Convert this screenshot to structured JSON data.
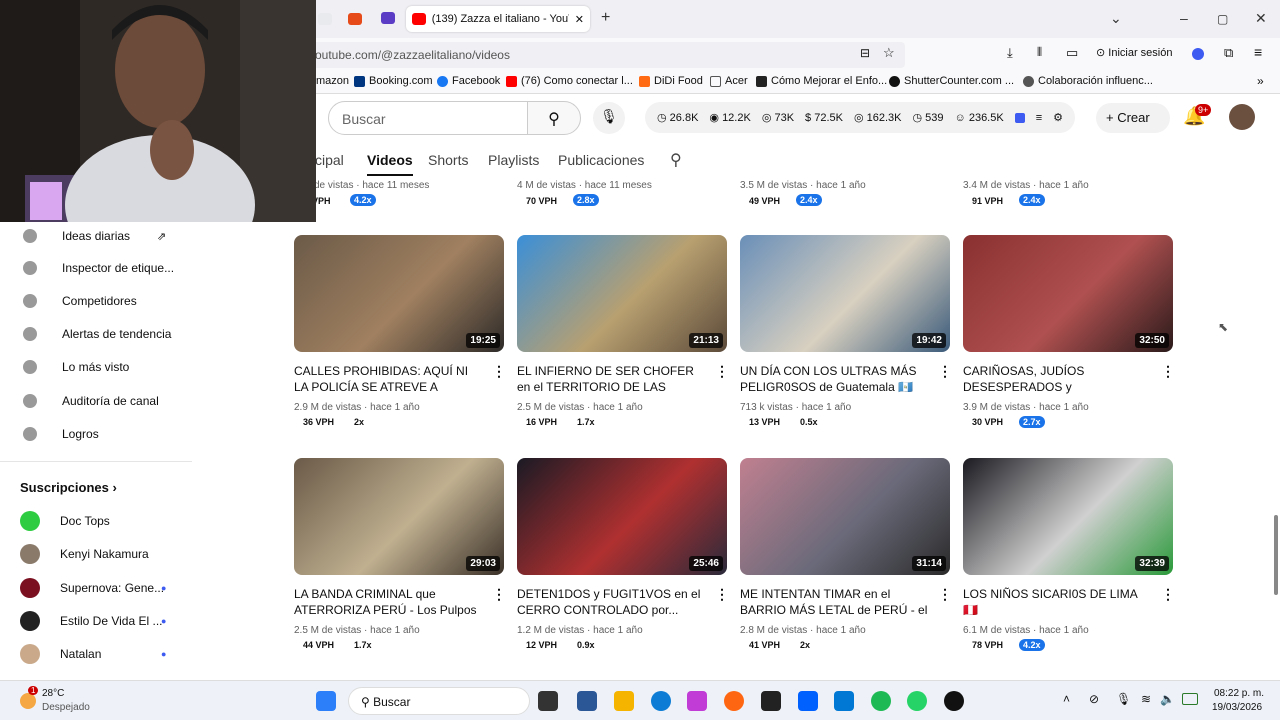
{
  "browser": {
    "active_tab_title": "(139) Zazza el italiano - YouTub",
    "url": "outube.com/@zazzaelitaliano/videos",
    "sign_in": "Iniciar sesión",
    "new_tab": "+",
    "bookmarks": [
      "mazon",
      "Booking.com",
      "Facebook",
      "(76) Como conectar l...",
      "DiDi Food",
      "Acer",
      "Cómo Mejorar el Enfo...",
      "ShutterCounter.com ...",
      "Colaboración influenc..."
    ]
  },
  "youtube": {
    "search_placeholder": "Buscar",
    "stats": [
      "26.8K",
      "12.2K",
      "73K",
      "72.5K",
      "162.3K",
      "539",
      "236.5K"
    ],
    "create_label": "Crear",
    "notif_badge": "9+",
    "channel_tabs": [
      "cipal",
      "Videos",
      "Shorts",
      "Playlists",
      "Publicaciones"
    ]
  },
  "sidebar": {
    "tools": [
      "Ideas diarias",
      "Inspector de etique...",
      "Competidores",
      "Alertas de tendencia",
      "Lo más visto",
      "Auditoría de canal",
      "Logros"
    ],
    "subs_title": "Suscripciones",
    "subscriptions": [
      "Doc Tops",
      "Kenyi Nakamura",
      "Supernova: Gene...",
      "Estilo De Vida El ...",
      "Natalan"
    ]
  },
  "top_row": [
    {
      "meta": "de vistas · hace 11 meses",
      "vph": "VPH",
      "mult": "4.2x"
    },
    {
      "meta": "4 M de vistas · hace 11 meses",
      "vph": "70 VPH",
      "mult": "2.8x"
    },
    {
      "meta": "3.5 M de vistas · hace 1 año",
      "vph": "49 VPH",
      "mult": "2.4x"
    },
    {
      "meta": "3.4 M de vistas · hace 1 año",
      "vph": "91 VPH",
      "mult": "2.4x"
    }
  ],
  "videos": [
    {
      "title": "CALLES PROHIBIDAS: AQUÍ NI LA POLICÍA SE ATREVE A ENTRAR - L...",
      "duration": "19:25",
      "meta": "2.9 M de vistas · hace 1 año",
      "vph": "36 VPH",
      "mult": "2x",
      "hi": false
    },
    {
      "title": "EL INFIERNO DE SER CHOFER en el TERRITORIO DE LAS MARAS 💀🇬🇹",
      "duration": "21:13",
      "meta": "2.5 M de vistas · hace 1 año",
      "vph": "16 VPH",
      "mult": "1.7x",
      "hi": false
    },
    {
      "title": "UN DÍA CON LOS ULTRAS MÁS PELIGR0SOS de Guatemala 🇬🇹",
      "duration": "19:42",
      "meta": "713 k vistas · hace 1 año",
      "vph": "13 VPH",
      "mult": "0.5x",
      "hi": false
    },
    {
      "title": "CARIÑOSAS, JUDÍOS DESESPERADOS y SECUESTR0S e...",
      "duration": "32:50",
      "meta": "3.9 M de vistas · hace 1 año",
      "vph": "30 VPH",
      "mult": "2.7x",
      "hi": true
    },
    {
      "title": "LA BANDA CRIMINAL que ATERRORIZA PERÚ - Los Pulpos 🇵🇪",
      "duration": "29:03",
      "meta": "2.5 M de vistas · hace 1 año",
      "vph": "44 VPH",
      "mult": "1.7x",
      "hi": false
    },
    {
      "title": "DETEN1DOS y FUGIT1VOS en el CERRO CONTROLADO por...",
      "duration": "25:46",
      "meta": "1.2 M de vistas · hace 1 año",
      "vph": "12 VPH",
      "mult": "0.9x",
      "hi": false
    },
    {
      "title": "ME INTENTAN TIMAR en el BARRIO MÁS LETAL de PERÚ - el Callao 🇵🇪",
      "duration": "31:14",
      "meta": "2.8 M de vistas · hace 1 año",
      "vph": "41 VPH",
      "mult": "2x",
      "hi": false
    },
    {
      "title": "LOS NIÑOS SICARI0S DE LIMA 🇵🇪",
      "duration": "32:39",
      "meta": "6.1 M de vistas · hace 1 año",
      "vph": "78 VPH",
      "mult": "4.2x",
      "hi": true
    }
  ],
  "taskbar": {
    "weather_temp": "28°C",
    "weather_desc": "Despejado",
    "weather_badge": "1",
    "search": "Buscar",
    "time": "08:22 p. m.",
    "date": "19/03/2026"
  },
  "colors": {
    "yt_red": "#ff0000",
    "badge_blue": "#1a73e8",
    "notif_red": "#cc0000"
  }
}
